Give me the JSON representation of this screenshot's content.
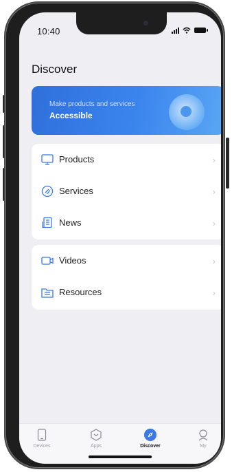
{
  "status_bar": {
    "time": "10:40"
  },
  "page": {
    "title": "Discover"
  },
  "banner": {
    "subtitle": "Make products and services",
    "headline": "Accessible"
  },
  "menu_groups": [
    {
      "items": [
        {
          "label": "Products",
          "icon": "monitor-icon"
        },
        {
          "label": "Services",
          "icon": "services-icon"
        },
        {
          "label": "News",
          "icon": "news-icon"
        }
      ]
    },
    {
      "items": [
        {
          "label": "Videos",
          "icon": "video-camera-icon"
        },
        {
          "label": "Resources",
          "icon": "folder-icon"
        }
      ]
    }
  ],
  "bottom_nav": {
    "items": [
      {
        "label": "Devices",
        "icon": "device-icon"
      },
      {
        "label": "Apps",
        "icon": "apps-hexagon-icon"
      },
      {
        "label": "Discover",
        "icon": "compass-icon",
        "active": true
      },
      {
        "label": "My",
        "icon": "user-icon"
      }
    ]
  },
  "colors": {
    "accent": "#3b79e6",
    "banner_start": "#2f6fdc",
    "banner_end": "#5aa6f4",
    "background": "#efeff3"
  }
}
